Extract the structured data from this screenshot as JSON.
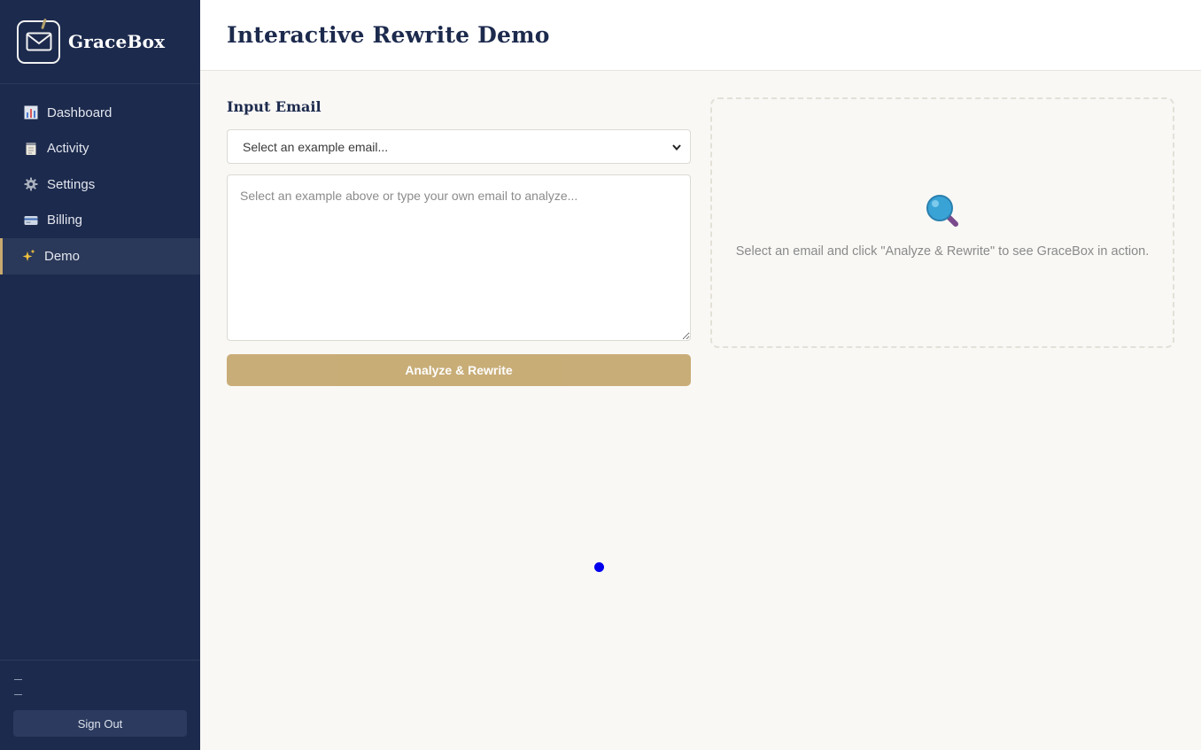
{
  "brand": {
    "name": "GraceBox",
    "logo_icon": "mail-icon"
  },
  "sidebar": {
    "items": [
      {
        "label": "Dashboard",
        "icon": "bar-chart-icon",
        "active": false
      },
      {
        "label": "Activity",
        "icon": "notepad-icon",
        "active": false
      },
      {
        "label": "Settings",
        "icon": "gear-icon",
        "active": false
      },
      {
        "label": "Billing",
        "icon": "credit-card-icon",
        "active": false
      },
      {
        "label": "Demo",
        "icon": "sparkles-icon",
        "active": true
      }
    ],
    "footer": {
      "line1": "—",
      "line2": "—",
      "signout_label": "Sign Out"
    }
  },
  "header": {
    "title": "Interactive Rewrite Demo"
  },
  "input": {
    "section_label": "Input Email",
    "select_value": "Select an example email...",
    "textarea_placeholder": "Select an example above or type your own email to analyze...",
    "textarea_value": "",
    "analyze_label": "Analyze & Rewrite"
  },
  "result": {
    "icon": "magnifier-icon",
    "empty_message": "Select an email and click \"Analyze & Rewrite\" to see GraceBox in action."
  },
  "colors": {
    "sidebar_bg": "#1c2a4d",
    "accent": "#c6a971",
    "page_bg": "#f9f8f5"
  }
}
